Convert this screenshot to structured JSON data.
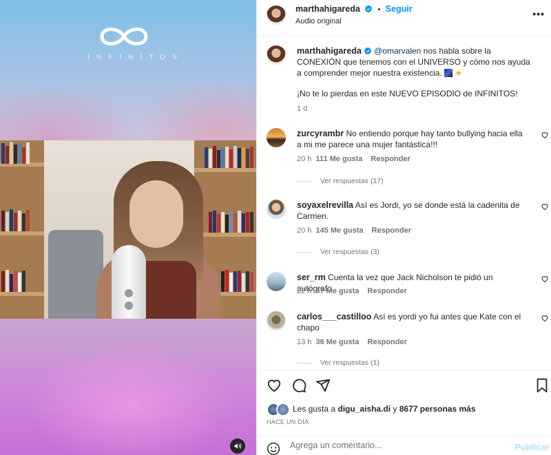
{
  "media": {
    "brand_text": "INFINITOS"
  },
  "post_header": {
    "username": "marthahigareda",
    "separator": "•",
    "follow_label": "Seguir",
    "audio_label": "Audio original"
  },
  "caption": {
    "username": "marthahigareda",
    "mention": "@omarvalen",
    "line1": " nos habla sobre la CONEXIÓN que tenemos con el UNIVERSO y cómo nos ayuda a comprender mejor nuestra existencia. ",
    "line2": "¡No te lo pierdas en este NUEVO EPISODIO de INFINITOS!",
    "time": "1 d"
  },
  "comments": [
    {
      "username": "zurcyrambr",
      "text": "No entiendo porque hay tanto bullying hacia ella a mi me parece una mujer fantástica!!!",
      "time": "20 h",
      "likes": "111 Me gusta",
      "reply_label": "Responder",
      "view_replies": "Ver respuestas (17)"
    },
    {
      "username": "soyaxelrevilla",
      "text": "Así es Jordi, yo se donde está la cadenita de Carmen.",
      "time": "20 h",
      "likes": "145 Me gusta",
      "reply_label": "Responder",
      "view_replies": "Ver respuestas (3)"
    },
    {
      "username": "ser_rm",
      "text": "Cuenta la vez que Jack Nicholson te pidió un autógrafo",
      "time": "22 h",
      "likes": "87 Me gusta",
      "reply_label": "Responder"
    },
    {
      "username": "carlos___castilloo",
      "text": "Así es yordi yo fui antes que Kate con el chapo",
      "time": "13 h",
      "likes": "36 Me gusta",
      "reply_label": "Responder",
      "view_replies": "Ver respuestas (1)"
    }
  ],
  "likes_summary": {
    "prefix": "Les gusta a ",
    "user": "digu_aisha.di",
    "middle": " y ",
    "count": "8677 personas más"
  },
  "time_ago": "HACE UN DÍA",
  "add_comment": {
    "placeholder": "Agrega un comentario...",
    "publish_label": "Publicar"
  },
  "colors": {
    "accent": "#0095f6",
    "publish_disabled": "#b2dffc",
    "mention": "#00376b",
    "muted": "#737373"
  }
}
